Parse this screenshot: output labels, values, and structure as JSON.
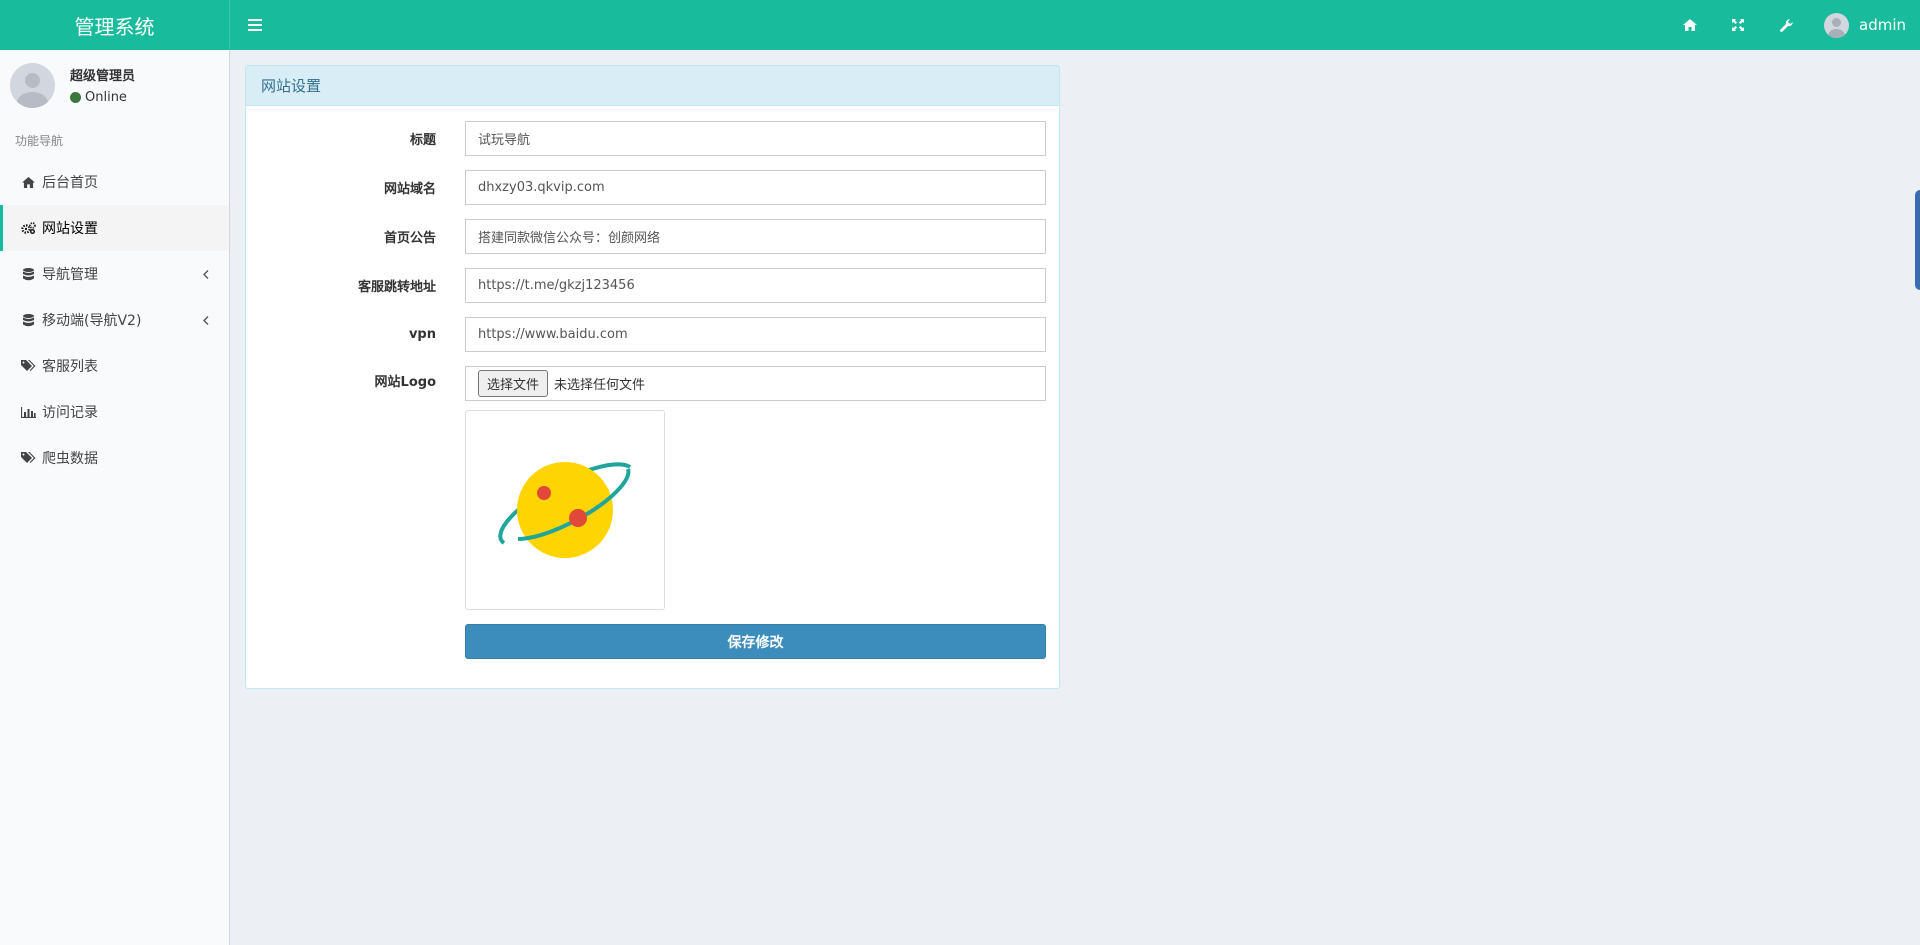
{
  "header": {
    "logo": "管理系统",
    "toggle_icon": "bars-icon",
    "right_icons": [
      "home-icon",
      "expand-icon",
      "wrench-icon"
    ],
    "username": "admin"
  },
  "sidebar": {
    "user": {
      "name": "超级管理员",
      "status": "Online",
      "status_color": "#3c763d"
    },
    "nav_header": "功能导航",
    "items": [
      {
        "label": "后台首页",
        "icon": "home-icon"
      },
      {
        "label": "网站设置",
        "icon": "cogs-icon",
        "active": true
      },
      {
        "label": "导航管理",
        "icon": "database-icon",
        "has_submenu": true
      },
      {
        "label": "移动端(导航V2)",
        "icon": "database-icon",
        "has_submenu": true
      },
      {
        "label": "客服列表",
        "icon": "tags-icon"
      },
      {
        "label": "访问记录",
        "icon": "bar-chart-icon"
      },
      {
        "label": "爬虫数据",
        "icon": "tags-icon"
      }
    ]
  },
  "form": {
    "panel_title": "网站设置",
    "fields": [
      {
        "label": "标题",
        "value": "试玩导航"
      },
      {
        "label": "网站域名",
        "value": "dhxzy03.qkvip.com"
      },
      {
        "label": "首页公告",
        "value": "搭建同款微信公众号：创颜网络"
      },
      {
        "label": "客服跳转地址",
        "value": "https://t.me/gkzj123456"
      },
      {
        "label": "vpn",
        "value": "https://www.baidu.com"
      }
    ],
    "logo_label": "网站Logo",
    "file_button": "选择文件",
    "file_status": "未选择任何文件",
    "logo_image": "planet-logo",
    "save_button": "保存修改"
  },
  "colors": {
    "header": "#18bc9c",
    "panel_heading": "#d9edf7",
    "primary_button": "#3c8dbc",
    "planet": "#ffd400",
    "ring": "#1fa59b",
    "spots": "#e0483a"
  }
}
